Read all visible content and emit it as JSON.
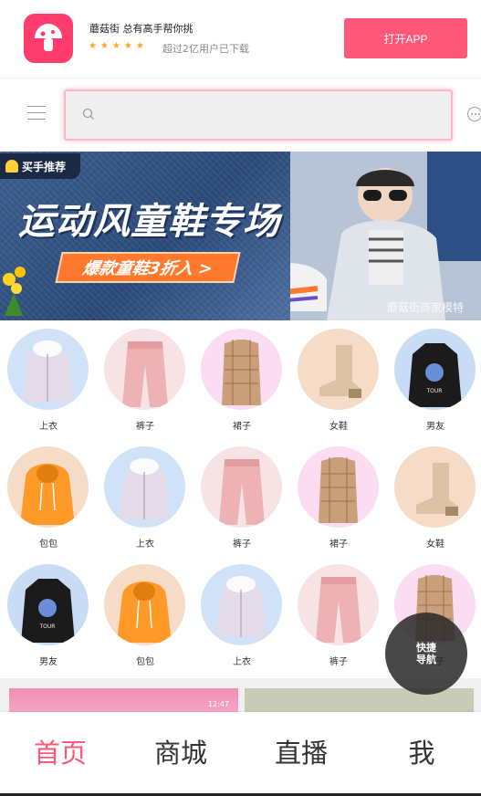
{
  "app_banner": {
    "name": "蘑菇街 总有高手帮你挑",
    "stars": "★★★★★",
    "downloads": "超过2亿用户已下载",
    "open_button": "打开APP"
  },
  "search": {
    "placeholder": "",
    "value": ""
  },
  "hero": {
    "badge": "买手推荐",
    "title": "运动风童鞋专场",
    "tag": "爆款童鞋3折入 >",
    "watermark": "蘑菇街商家模特"
  },
  "categories": [
    {
      "label": "上衣",
      "image": "jacket"
    },
    {
      "label": "裤子",
      "image": "pants"
    },
    {
      "label": "裙子",
      "image": "plaid"
    },
    {
      "label": "女鞋",
      "image": "boot"
    },
    {
      "label": "男友",
      "image": "hoodie-black"
    },
    {
      "label": "包包",
      "image": "hoodie-orange"
    },
    {
      "label": "上衣",
      "image": "jacket"
    },
    {
      "label": "裤子",
      "image": "pants"
    },
    {
      "label": "裙子",
      "image": "plaid"
    },
    {
      "label": "女鞋",
      "image": "boot"
    },
    {
      "label": "男友",
      "image": "hoodie-black"
    },
    {
      "label": "包包",
      "image": "hoodie-orange"
    },
    {
      "label": "上衣",
      "image": "jacket"
    },
    {
      "label": "裤子",
      "image": "pants"
    },
    {
      "label": "裙子",
      "image": "plaid"
    }
  ],
  "product_strip": {
    "status_text": "12:47"
  },
  "quick_nav": {
    "label": "快捷导航"
  },
  "tabbar": {
    "items": [
      {
        "label": "首页",
        "active": true
      },
      {
        "label": "商城",
        "active": false
      },
      {
        "label": "直播",
        "active": false
      },
      {
        "label": "我",
        "active": false
      }
    ]
  },
  "colors": {
    "brand": "#ff5777",
    "star": "#ffa32b",
    "hero_tag": "#ff7a2e"
  }
}
